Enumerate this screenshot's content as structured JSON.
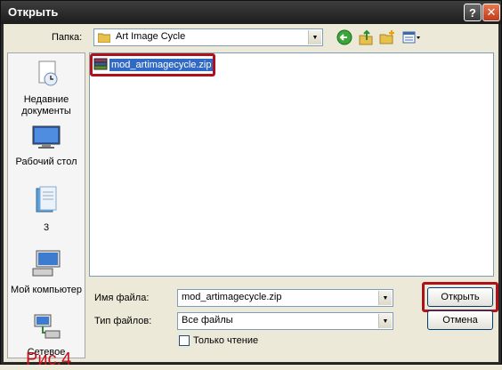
{
  "window": {
    "title": "Открыть",
    "help_glyph": "?",
    "close_glyph": "✕"
  },
  "toolbar": {
    "folder_label": "Папка:",
    "folder_value": "Art Image Cycle"
  },
  "places": [
    {
      "label": "Недавние документы",
      "icon": "recent-documents-icon"
    },
    {
      "label": "Рабочий стол",
      "icon": "desktop-icon"
    },
    {
      "label": "3",
      "icon": "my-documents-icon"
    },
    {
      "label": "Мой компьютер",
      "icon": "my-computer-icon"
    },
    {
      "label": "Сетевое",
      "icon": "network-icon"
    }
  ],
  "files": [
    {
      "name": "mod_artimagecycle.zip",
      "icon": "zip-archive-icon"
    }
  ],
  "form": {
    "filename_label": "Имя файла:",
    "filename_value": "mod_artimagecycle.zip",
    "filetype_label": "Тип файлов:",
    "filetype_value": "Все файлы",
    "readonly_label": "Только чтение"
  },
  "buttons": {
    "open": "Открыть",
    "cancel": "Отмена"
  },
  "caption": "Рис.4",
  "colors": {
    "highlight": "#b0101a",
    "selection": "#316ac5",
    "caption": "#c8101c"
  }
}
